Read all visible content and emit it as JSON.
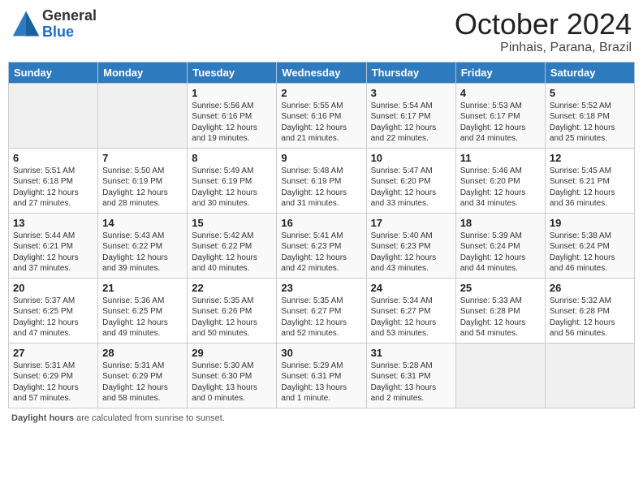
{
  "header": {
    "logo_general": "General",
    "logo_blue": "Blue",
    "month_title": "October 2024",
    "location": "Pinhais, Parana, Brazil"
  },
  "days_of_week": [
    "Sunday",
    "Monday",
    "Tuesday",
    "Wednesday",
    "Thursday",
    "Friday",
    "Saturday"
  ],
  "weeks": [
    [
      {
        "day": "",
        "sunrise": "",
        "sunset": "",
        "daylight": ""
      },
      {
        "day": "",
        "sunrise": "",
        "sunset": "",
        "daylight": ""
      },
      {
        "day": "1",
        "sunrise": "Sunrise: 5:56 AM",
        "sunset": "Sunset: 6:16 PM",
        "daylight": "Daylight: 12 hours and 19 minutes."
      },
      {
        "day": "2",
        "sunrise": "Sunrise: 5:55 AM",
        "sunset": "Sunset: 6:16 PM",
        "daylight": "Daylight: 12 hours and 21 minutes."
      },
      {
        "day": "3",
        "sunrise": "Sunrise: 5:54 AM",
        "sunset": "Sunset: 6:17 PM",
        "daylight": "Daylight: 12 hours and 22 minutes."
      },
      {
        "day": "4",
        "sunrise": "Sunrise: 5:53 AM",
        "sunset": "Sunset: 6:17 PM",
        "daylight": "Daylight: 12 hours and 24 minutes."
      },
      {
        "day": "5",
        "sunrise": "Sunrise: 5:52 AM",
        "sunset": "Sunset: 6:18 PM",
        "daylight": "Daylight: 12 hours and 25 minutes."
      }
    ],
    [
      {
        "day": "6",
        "sunrise": "Sunrise: 5:51 AM",
        "sunset": "Sunset: 6:18 PM",
        "daylight": "Daylight: 12 hours and 27 minutes."
      },
      {
        "day": "7",
        "sunrise": "Sunrise: 5:50 AM",
        "sunset": "Sunset: 6:19 PM",
        "daylight": "Daylight: 12 hours and 28 minutes."
      },
      {
        "day": "8",
        "sunrise": "Sunrise: 5:49 AM",
        "sunset": "Sunset: 6:19 PM",
        "daylight": "Daylight: 12 hours and 30 minutes."
      },
      {
        "day": "9",
        "sunrise": "Sunrise: 5:48 AM",
        "sunset": "Sunset: 6:19 PM",
        "daylight": "Daylight: 12 hours and 31 minutes."
      },
      {
        "day": "10",
        "sunrise": "Sunrise: 5:47 AM",
        "sunset": "Sunset: 6:20 PM",
        "daylight": "Daylight: 12 hours and 33 minutes."
      },
      {
        "day": "11",
        "sunrise": "Sunrise: 5:46 AM",
        "sunset": "Sunset: 6:20 PM",
        "daylight": "Daylight: 12 hours and 34 minutes."
      },
      {
        "day": "12",
        "sunrise": "Sunrise: 5:45 AM",
        "sunset": "Sunset: 6:21 PM",
        "daylight": "Daylight: 12 hours and 36 minutes."
      }
    ],
    [
      {
        "day": "13",
        "sunrise": "Sunrise: 5:44 AM",
        "sunset": "Sunset: 6:21 PM",
        "daylight": "Daylight: 12 hours and 37 minutes."
      },
      {
        "day": "14",
        "sunrise": "Sunrise: 5:43 AM",
        "sunset": "Sunset: 6:22 PM",
        "daylight": "Daylight: 12 hours and 39 minutes."
      },
      {
        "day": "15",
        "sunrise": "Sunrise: 5:42 AM",
        "sunset": "Sunset: 6:22 PM",
        "daylight": "Daylight: 12 hours and 40 minutes."
      },
      {
        "day": "16",
        "sunrise": "Sunrise: 5:41 AM",
        "sunset": "Sunset: 6:23 PM",
        "daylight": "Daylight: 12 hours and 42 minutes."
      },
      {
        "day": "17",
        "sunrise": "Sunrise: 5:40 AM",
        "sunset": "Sunset: 6:23 PM",
        "daylight": "Daylight: 12 hours and 43 minutes."
      },
      {
        "day": "18",
        "sunrise": "Sunrise: 5:39 AM",
        "sunset": "Sunset: 6:24 PM",
        "daylight": "Daylight: 12 hours and 44 minutes."
      },
      {
        "day": "19",
        "sunrise": "Sunrise: 5:38 AM",
        "sunset": "Sunset: 6:24 PM",
        "daylight": "Daylight: 12 hours and 46 minutes."
      }
    ],
    [
      {
        "day": "20",
        "sunrise": "Sunrise: 5:37 AM",
        "sunset": "Sunset: 6:25 PM",
        "daylight": "Daylight: 12 hours and 47 minutes."
      },
      {
        "day": "21",
        "sunrise": "Sunrise: 5:36 AM",
        "sunset": "Sunset: 6:25 PM",
        "daylight": "Daylight: 12 hours and 49 minutes."
      },
      {
        "day": "22",
        "sunrise": "Sunrise: 5:35 AM",
        "sunset": "Sunset: 6:26 PM",
        "daylight": "Daylight: 12 hours and 50 minutes."
      },
      {
        "day": "23",
        "sunrise": "Sunrise: 5:35 AM",
        "sunset": "Sunset: 6:27 PM",
        "daylight": "Daylight: 12 hours and 52 minutes."
      },
      {
        "day": "24",
        "sunrise": "Sunrise: 5:34 AM",
        "sunset": "Sunset: 6:27 PM",
        "daylight": "Daylight: 12 hours and 53 minutes."
      },
      {
        "day": "25",
        "sunrise": "Sunrise: 5:33 AM",
        "sunset": "Sunset: 6:28 PM",
        "daylight": "Daylight: 12 hours and 54 minutes."
      },
      {
        "day": "26",
        "sunrise": "Sunrise: 5:32 AM",
        "sunset": "Sunset: 6:28 PM",
        "daylight": "Daylight: 12 hours and 56 minutes."
      }
    ],
    [
      {
        "day": "27",
        "sunrise": "Sunrise: 5:31 AM",
        "sunset": "Sunset: 6:29 PM",
        "daylight": "Daylight: 12 hours and 57 minutes."
      },
      {
        "day": "28",
        "sunrise": "Sunrise: 5:31 AM",
        "sunset": "Sunset: 6:29 PM",
        "daylight": "Daylight: 12 hours and 58 minutes."
      },
      {
        "day": "29",
        "sunrise": "Sunrise: 5:30 AM",
        "sunset": "Sunset: 6:30 PM",
        "daylight": "Daylight: 13 hours and 0 minutes."
      },
      {
        "day": "30",
        "sunrise": "Sunrise: 5:29 AM",
        "sunset": "Sunset: 6:31 PM",
        "daylight": "Daylight: 13 hours and 1 minute."
      },
      {
        "day": "31",
        "sunrise": "Sunrise: 5:28 AM",
        "sunset": "Sunset: 6:31 PM",
        "daylight": "Daylight: 13 hours and 2 minutes."
      },
      {
        "day": "",
        "sunrise": "",
        "sunset": "",
        "daylight": ""
      },
      {
        "day": "",
        "sunrise": "",
        "sunset": "",
        "daylight": ""
      }
    ]
  ],
  "footer": {
    "label": "Daylight hours",
    "text": " are calculated from sunrise to sunset."
  }
}
